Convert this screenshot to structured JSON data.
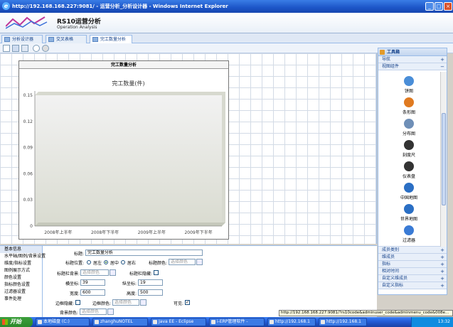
{
  "window": {
    "title": "http://192.168.168.227:9081/ - 运营分析_分析设计器 - Windows Internet Explorer"
  },
  "banner": {
    "title": "RS10运营分析",
    "subtitle": "Operation Analysis"
  },
  "tabs": [
    {
      "label": "分析设计器"
    },
    {
      "label": "交叉表格"
    },
    {
      "label": "完工数量分析"
    }
  ],
  "chart_panel": {
    "header": "完工数量分析"
  },
  "chart_data": {
    "type": "bar",
    "title": "完工数量(件)",
    "categories": [
      "2008年上半年",
      "2008年下半年",
      "2009年上半年",
      "2009年下半年"
    ],
    "values": [
      0,
      0,
      0,
      0
    ],
    "yticks": [
      "0.15",
      "0.12",
      "0.09",
      "0.06",
      "0.03",
      "0"
    ],
    "ylim": [
      0,
      0.15
    ],
    "grid": false
  },
  "toolbox": {
    "title": "工具箱",
    "sections_top": [
      {
        "label": "导航"
      },
      {
        "label": "视图组件"
      }
    ],
    "widgets": [
      {
        "label": "饼图",
        "icon": "pie-chart-icon",
        "color": "#4a8ed8"
      },
      {
        "label": "条形图",
        "icon": "bar-chart-icon",
        "color": "#e07a20"
      },
      {
        "label": "分布图",
        "icon": "scatter-chart-icon",
        "color": "#6f8fb7"
      },
      {
        "label": "刻度尺",
        "icon": "dial-icon",
        "color": "#333333"
      },
      {
        "label": "仪表盘",
        "icon": "gauge-icon",
        "color": "#333333"
      },
      {
        "label": "中国地图",
        "icon": "china-map-icon",
        "color": "#2b6fc4"
      },
      {
        "label": "世界地图",
        "icon": "world-map-icon",
        "color": "#2b6fc4"
      },
      {
        "label": "过滤器",
        "icon": "filter-icon",
        "color": "#3a7bd5"
      }
    ],
    "sections_bottom": [
      {
        "label": "成员类别"
      },
      {
        "label": "维成员"
      },
      {
        "label": "指标"
      },
      {
        "label": "相对时间"
      },
      {
        "label": "自定义维成员"
      },
      {
        "label": "自定义指标"
      }
    ]
  },
  "props": {
    "menu": [
      {
        "label": "基本信息"
      },
      {
        "label": "水平轴/图例/背景设置"
      },
      {
        "label": "维度/指标设置"
      },
      {
        "label": "图例展示方式"
      },
      {
        "label": "颜色设置"
      },
      {
        "label": "指标颜色设置"
      },
      {
        "label": "过滤器设置"
      },
      {
        "label": "事件处理"
      }
    ],
    "title_label": "标题:",
    "title_value": "完工数量分析",
    "title_pos_label": "标题位置:",
    "pos_left": "居左",
    "pos_center": "居中",
    "pos_right": "居右",
    "title_color_label": "标题颜色:",
    "title_color_ph": "选择颜色",
    "title_bg_label": "标题栏背景:",
    "title_bg_ph": "选择颜色",
    "title_hide_label": "标题栏隐藏:",
    "x_label": "横坐标:",
    "x_value": "39",
    "y_label": "纵坐标:",
    "y_value": "19",
    "w_label": "宽度:",
    "w_value": "600",
    "h_label": "高度:",
    "h_value": "500",
    "border_hide_label": "边框隐藏:",
    "border_color_label": "边框颜色:",
    "border_color_ph": "选择颜色",
    "visible_label": "可见:",
    "bg_color_label": "背景颜色:",
    "bg_color_ph": "选择颜色"
  },
  "status": {
    "url": "http://192.168.168.227:9081/?rs10code&adminuser_code&adminmenu_code&008e..."
  },
  "taskbar": {
    "start": "开始",
    "tasks": [
      {
        "label": "本地磁盘 (C:)"
      },
      {
        "label": "zhanghuNOTEL"
      },
      {
        "label": "Java EE - Eclipse"
      },
      {
        "label": "i-ERP管理软件 -"
      },
      {
        "label": "http://192.168.1"
      },
      {
        "label": "http://192.168.1"
      }
    ],
    "clock": "13:32"
  }
}
